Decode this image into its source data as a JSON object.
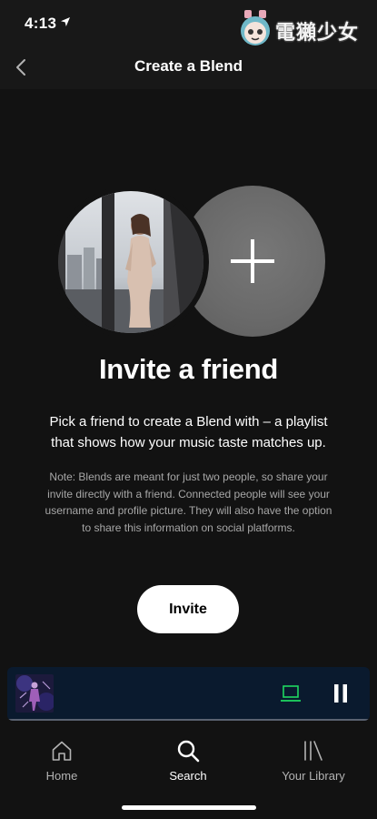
{
  "status_bar": {
    "time": "4:13",
    "watermark_text": "電獺少女"
  },
  "header": {
    "title": "Create a Blend"
  },
  "blend": {
    "heading": "Invite a friend",
    "description": "Pick a friend to create a Blend with – a playlist that shows how your music taste matches up.",
    "note": "Note: Blends are meant for just two people, so share your invite directly with a friend. Connected people will see your username and profile picture. They will also have the option to share this information on social platforms.",
    "invite_label": "Invite"
  },
  "player": {
    "progress": 0.0,
    "accent_color": "#1ed760"
  },
  "tabs": [
    {
      "label": "Home",
      "icon": "home-icon",
      "active": false
    },
    {
      "label": "Search",
      "icon": "search-icon",
      "active": true
    },
    {
      "label": "Your Library",
      "icon": "library-icon",
      "active": false
    }
  ],
  "colors": {
    "background": "#121212",
    "header": "#181818",
    "mini_player": "#0a1a2e"
  }
}
